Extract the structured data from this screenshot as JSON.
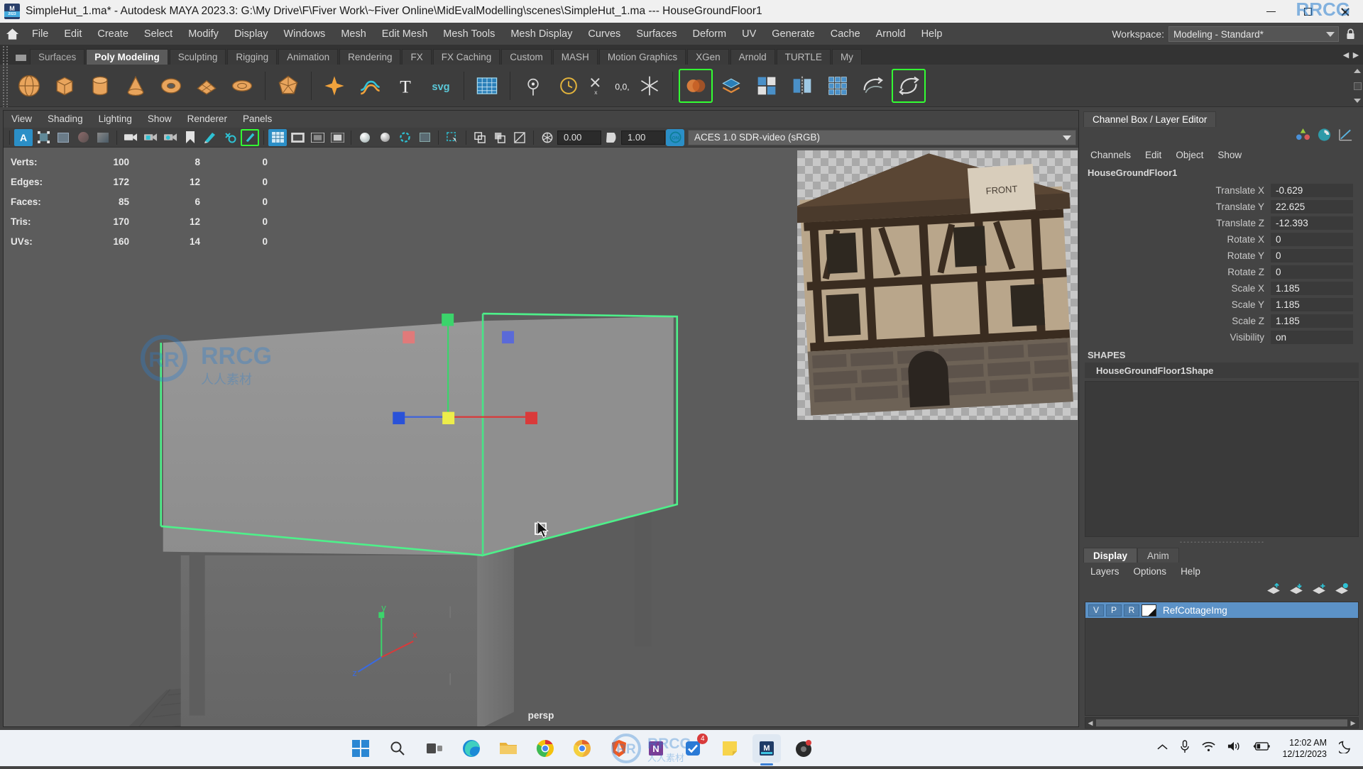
{
  "window": {
    "title": "SimpleHut_1.ma* - Autodesk MAYA 2023.3: G:\\My Drive\\F\\Fiver Work\\~Fiver Online\\MidEvalModelling\\scenes\\SimpleHut_1.ma  ---  HouseGroundFloor1",
    "minimize": "minimize",
    "maximize": "restore",
    "close": "close"
  },
  "menubar": {
    "home_icon": "home-icon",
    "items": [
      "File",
      "Edit",
      "Create",
      "Select",
      "Modify",
      "Display",
      "Windows",
      "Mesh",
      "Edit Mesh",
      "Mesh Tools",
      "Mesh Display",
      "Curves",
      "Surfaces",
      "Deform",
      "UV",
      "Generate",
      "Cache",
      "Arnold",
      "Help"
    ],
    "workspace_label": "Workspace:",
    "workspace_value": "Modeling - Standard*",
    "lock_icon": "lock-icon"
  },
  "shelf": {
    "tabs": [
      "Surfaces",
      "Poly Modeling",
      "Sculpting",
      "Rigging",
      "Animation",
      "Rendering",
      "FX",
      "FX Caching",
      "Custom",
      "MASH",
      "Motion Graphics",
      "XGen",
      "Arnold",
      "TURTLE",
      "My"
    ],
    "active_tab": "Poly Modeling",
    "buttons": [
      {
        "name": "poly-sphere-button",
        "icon": "sphere-icon"
      },
      {
        "name": "poly-cube-button",
        "icon": "cube-icon"
      },
      {
        "name": "poly-cylinder-button",
        "icon": "cylinder-icon"
      },
      {
        "name": "poly-cone-button",
        "icon": "cone-icon"
      },
      {
        "name": "poly-torus-button",
        "icon": "torus-icon"
      },
      {
        "name": "poly-plane-button",
        "icon": "plane-icon"
      },
      {
        "name": "poly-disc-button",
        "icon": "disc-icon"
      },
      {
        "name": "poly-platonic-button",
        "icon": "platonic-icon"
      },
      {
        "name": "poly-superellipse-button",
        "icon": "star-icon"
      },
      {
        "name": "poly-type-curve-button",
        "icon": "curve-icon"
      },
      {
        "name": "poly-type-text-button",
        "icon": "text-icon"
      },
      {
        "name": "poly-svg-button",
        "icon": "svg-icon"
      },
      {
        "name": "poly-grid-button",
        "icon": "grid-icon"
      },
      {
        "name": "snap-point-button",
        "icon": "snap-icon"
      },
      {
        "name": "snap-time-button",
        "icon": "clock-icon"
      },
      {
        "name": "snap-origin-button",
        "icon": "origin-icon"
      },
      {
        "name": "freeze-button",
        "icon": "snowflake-icon"
      },
      {
        "name": "combine-button",
        "icon": "combine-icon"
      },
      {
        "name": "separate-button",
        "icon": "separate-icon"
      },
      {
        "name": "booleans-button",
        "icon": "boolean-icon"
      },
      {
        "name": "mirror-button",
        "icon": "mirror-icon"
      },
      {
        "name": "smooth-button",
        "icon": "smooth-icon"
      },
      {
        "name": "reduce-button",
        "icon": "reduce-icon"
      },
      {
        "name": "retopo-button",
        "icon": "retopo-icon"
      }
    ]
  },
  "viewport": {
    "menus": [
      "View",
      "Shading",
      "Lighting",
      "Show",
      "Renderer",
      "Panels"
    ],
    "toolbar": {
      "select_icon": "select-icon",
      "bbox_icon": "bounding-box-icon",
      "shaded_icon": "shaded-icon",
      "texture_icon": "textured-icon",
      "lights_icon": "lighting-icon",
      "camera_icon": "camera-icon",
      "camera_lock_icon": "camera-lock-icon",
      "camera_settings_icon": "camera-settings-icon",
      "bookmark_icon": "bookmark-icon",
      "grease_pencil_icon": "grease-pencil-icon",
      "paint_icon": "paint-select-icon",
      "xray_icon": "xray-icon",
      "grid_icon": "grid-toggle-icon",
      "film_gate_icon": "film-gate-icon",
      "resolution_gate_icon": "resolution-gate-icon",
      "gate_mask_icon": "gate-mask-icon",
      "wireframe_icon": "wireframe-on-shaded-icon",
      "smooth_shade_icon": "smooth-shade-icon",
      "flat_shade_icon": "flat-shade-icon",
      "hardware_tex_icon": "hardware-texturing-icon",
      "use_default_light_icon": "default-light-icon",
      "shadows_icon": "shadows-icon",
      "ao_icon": "ambient-occlusion-icon",
      "motion_blur_icon": "motion-blur-icon",
      "multisample_icon": "multisample-icon",
      "isolate_icon": "isolate-select-icon",
      "exposure_icon": "exposure-icon",
      "exposure_value": "0.00",
      "gamma_icon": "gamma-icon",
      "gamma_value": "1.00",
      "colormgmt_icon": "color-management-icon",
      "colorspace_value": "ACES 1.0 SDR-video (sRGB)",
      "colorspace_dropdown": "chevron-down-icon"
    },
    "hud_rows": [
      {
        "label": "Verts:",
        "total": "100",
        "selected": "8",
        "third": "0"
      },
      {
        "label": "Edges:",
        "total": "172",
        "selected": "12",
        "third": "0"
      },
      {
        "label": "Faces:",
        "total": "85",
        "selected": "6",
        "third": "0"
      },
      {
        "label": "Tris:",
        "total": "170",
        "selected": "12",
        "third": "0"
      },
      {
        "label": "UVs:",
        "total": "160",
        "selected": "14",
        "third": "0"
      }
    ],
    "camera_label": "persp",
    "axis_labels": {
      "x": "x",
      "y": "y",
      "z": "z"
    },
    "reference_image_label": "FRONT",
    "watermark": "RRCG"
  },
  "channelbox": {
    "tab": "Channel Box / Layer Editor",
    "icons": [
      "channel-box-icon",
      "attribute-editor-icon",
      "graph-editor-icon"
    ],
    "menus": [
      "Channels",
      "Edit",
      "Object",
      "Show"
    ],
    "object_name": "HouseGroundFloor1",
    "attributes": [
      {
        "name": "Translate X",
        "value": "-0.629"
      },
      {
        "name": "Translate Y",
        "value": "22.625"
      },
      {
        "name": "Translate Z",
        "value": "-12.393"
      },
      {
        "name": "Rotate X",
        "value": "0"
      },
      {
        "name": "Rotate Y",
        "value": "0"
      },
      {
        "name": "Rotate Z",
        "value": "0"
      },
      {
        "name": "Scale X",
        "value": "1.185"
      },
      {
        "name": "Scale Y",
        "value": "1.185"
      },
      {
        "name": "Scale Z",
        "value": "1.185"
      },
      {
        "name": "Visibility",
        "value": "on"
      }
    ],
    "shapes_label": "SHAPES",
    "shape_name": "HouseGroundFloor1Shape"
  },
  "layereditor": {
    "tabs": [
      "Display",
      "Anim"
    ],
    "active_tab": "Display",
    "menus": [
      "Layers",
      "Options",
      "Help"
    ],
    "buttons": [
      "move-layer-up-icon",
      "move-layer-down-icon",
      "new-layer-icon",
      "new-layer-from-selected-icon"
    ],
    "layers": [
      {
        "v": "V",
        "p": "P",
        "r": "R",
        "color_swatch": "layer-color-swatch",
        "name": "RefCottageImg",
        "selected": true
      }
    ],
    "hscroll": {
      "left": "chevron-left-icon",
      "right": "chevron-right-icon"
    }
  },
  "taskbar": {
    "items": [
      {
        "name": "start-button",
        "icon": "windows-logo-icon"
      },
      {
        "name": "search-button",
        "icon": "search-icon"
      },
      {
        "name": "task-view-button",
        "icon": "task-view-icon"
      },
      {
        "name": "edge-button",
        "icon": "edge-icon"
      },
      {
        "name": "file-explorer-button",
        "icon": "folder-icon"
      },
      {
        "name": "chrome-button",
        "icon": "chrome-icon"
      },
      {
        "name": "chrome-canary-button",
        "icon": "chrome-alt-icon"
      },
      {
        "name": "brave-button",
        "icon": "brave-icon"
      },
      {
        "name": "onenote-button",
        "icon": "onenote-icon",
        "badge": "4"
      },
      {
        "name": "todo-button",
        "icon": "checkmark-icon"
      },
      {
        "name": "sticky-notes-button",
        "icon": "sticky-note-icon"
      },
      {
        "name": "maya-button",
        "icon": "maya-icon",
        "active": true
      },
      {
        "name": "media-button",
        "icon": "media-icon"
      }
    ],
    "tray": {
      "overflow": "chevron-up-icon",
      "microphone": "microphone-icon",
      "wifi": "wifi-icon",
      "volume": "speaker-icon",
      "battery": "battery-charging-icon",
      "time": "12:02 AM",
      "date": "12/12/2023",
      "notifications": "moon-icon"
    },
    "watermark": "RRCG"
  }
}
